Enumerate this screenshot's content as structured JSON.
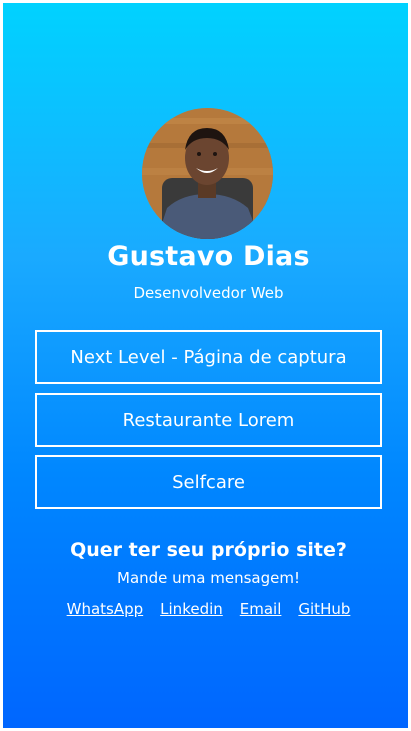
{
  "profile": {
    "name": "Gustavo Dias",
    "role": "Desenvolvedor Web"
  },
  "links": [
    {
      "label": "Next Level - Página de captura"
    },
    {
      "label": "Restaurante Lorem"
    },
    {
      "label": "Selfcare"
    }
  ],
  "contact": {
    "title": "Quer ter seu próprio site?",
    "subtitle": "Mande uma mensagem!",
    "social": [
      {
        "label": "WhatsApp"
      },
      {
        "label": "Linkedin"
      },
      {
        "label": "Email"
      },
      {
        "label": "GitHub"
      }
    ]
  },
  "colors": {
    "gradient_top": "#00d2ff",
    "gradient_bottom": "#0066ff",
    "text": "#ffffff"
  }
}
